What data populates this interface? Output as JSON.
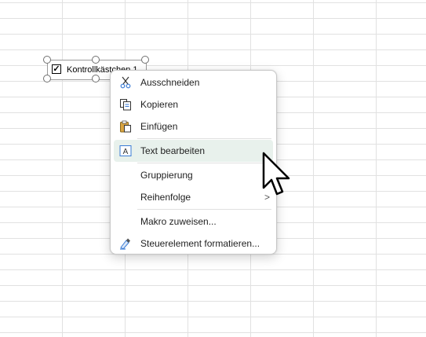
{
  "checkbox_control": {
    "label": "Kontrollkästchen 1",
    "checked_mark": "✓"
  },
  "context_menu": {
    "items": [
      {
        "label": "Ausschneiden",
        "icon": "scissors-icon"
      },
      {
        "label": "Kopieren",
        "icon": "copy-icon"
      },
      {
        "label": "Einfügen",
        "icon": "paste-icon"
      },
      {
        "label": "Text bearbeiten",
        "icon": "edit-text-icon",
        "highlighted": true
      },
      {
        "label": "Gruppierung"
      },
      {
        "label": "Reihenfolge",
        "submenu_arrow": ">"
      },
      {
        "label": "Makro zuweisen..."
      },
      {
        "label": "Steuerelement formatieren...",
        "icon": "format-control-icon"
      }
    ]
  },
  "colors": {
    "highlight": "#e8f1ec",
    "accent_blue": "#3a7bd5",
    "grid": "#e1e1e1"
  }
}
